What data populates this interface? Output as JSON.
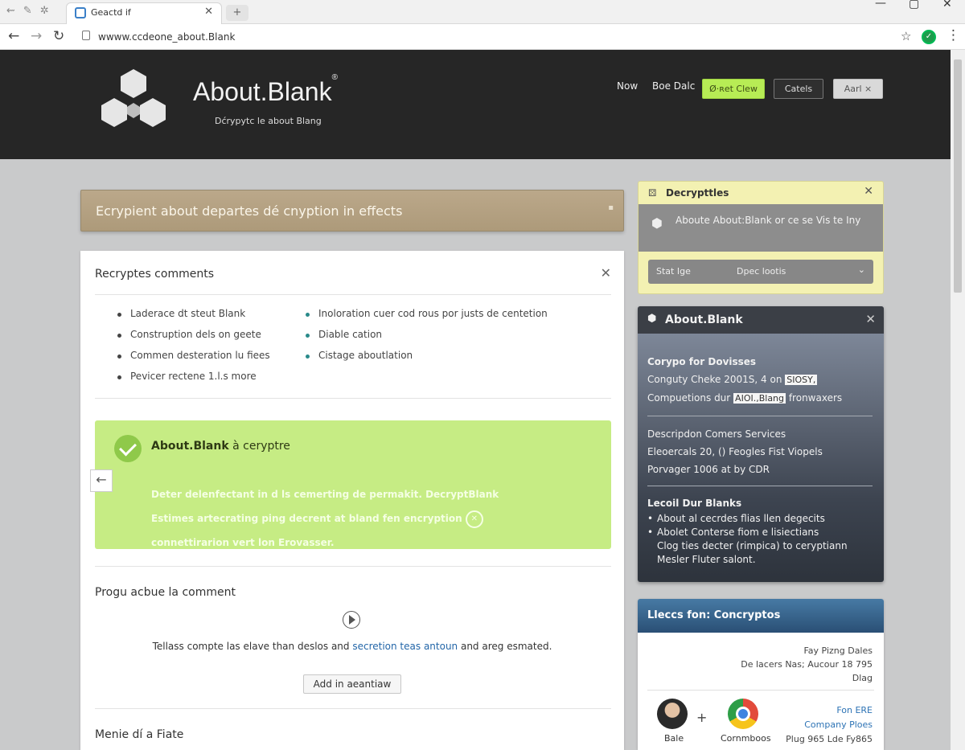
{
  "browser": {
    "tab_title": "Geactd if",
    "url": "wwww.ccdeone_about.Blank",
    "tab_left_glyphs": [
      "⇜",
      "✎",
      "✲"
    ]
  },
  "header": {
    "brand": "About.Blank",
    "brand_mark": "®",
    "tagline": "Dćrypytc le about Blang",
    "nav": [
      "Now",
      "Boe Dalc"
    ],
    "btn_green": "Ø·ʀet Clew",
    "btn_dark": "Catels",
    "btn_light": "Aarl ×"
  },
  "notice": {
    "text": "Ecrypient about departes dé cnyption in effects"
  },
  "comments": {
    "heading": "Recryptes comments",
    "left_items": [
      "Laderace dt steut Blank",
      "Construption dels on geete",
      "Commen desteration lu fiees",
      "Pevicer rectene 1.l.s more"
    ],
    "right_items": [
      "Inoloration cuer cod rous por justs de centetion",
      "Diable cation",
      "Cistage aboutlation"
    ]
  },
  "success": {
    "title_bold": "About.Blank",
    "title_rest": " à cerypt​re",
    "line1": "Deter delenfectant in d ls cemerting de permakit. DecryptBlank",
    "line2": "Estimes artecrating ping decrent at bland fen encryption",
    "line2_icon": "✕",
    "line3": "connettirarion vert lon Erovasser."
  },
  "section2": {
    "heading": "Progu acbue la comment",
    "desc_plain": "Tellass compte las elave than deslos and ",
    "desc_link": "secretion teas antoun",
    "desc_tail": " and areg esmated.",
    "add_button": "Add in aeantiaw"
  },
  "section3": {
    "heading": "Menie dí a Fiate"
  },
  "widget_yellow": {
    "title": "Decrypttles",
    "info": "Aboute About:Blank or ce se Vis te Iny",
    "select_a": "Stat Ige",
    "select_b": "Dpec lootis"
  },
  "widget_dark": {
    "title": "About.Blank",
    "b1_head": "Corypo for Dovisses",
    "b1_l1a": "Conguty Cheke 2001S, 4 on ",
    "b1_l1hl": "SIOSY,",
    "b1_l2a": "Compuetions dur ",
    "b1_l2hl": "AIOI.,Blang",
    "b1_l2b": " fronwaxers",
    "b2_l1": "Descripdon Comers Services",
    "b2_l2": "Eleoercals 20, () Feogles Fist Viopels",
    "b2_l3": "Porvager 1006 at by CDR",
    "b3_head": "Lecoil Dur Blanks",
    "b3_items": [
      "About al cecrdes flias llen degecits",
      "Abolet Conterse fiom e lisiectians",
      "Clog ties decter (rimpica) to ceryptiann",
      "Mesler Fluter salont."
    ]
  },
  "widget_blue": {
    "title": "Lleccs fon: Concryptos",
    "meta1": "Fay Pizng Dales",
    "meta2": "De lacers Nas; Aucour 18 795",
    "meta3": "Dlag",
    "avatar_label": "Bale",
    "chrome_label": "Cornmboos",
    "link1": "Fon ERE",
    "link2": "Company Ploes",
    "link3": "Plug 965 Lde Fy865"
  }
}
